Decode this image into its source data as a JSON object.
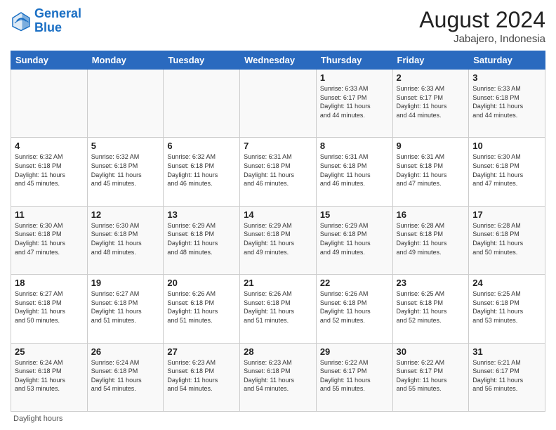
{
  "header": {
    "logo_line1": "General",
    "logo_line2": "Blue",
    "month_year": "August 2024",
    "location": "Jabajero, Indonesia"
  },
  "days_of_week": [
    "Sunday",
    "Monday",
    "Tuesday",
    "Wednesday",
    "Thursday",
    "Friday",
    "Saturday"
  ],
  "footer": {
    "daylight_label": "Daylight hours"
  },
  "weeks": [
    [
      {
        "day": "",
        "info": ""
      },
      {
        "day": "",
        "info": ""
      },
      {
        "day": "",
        "info": ""
      },
      {
        "day": "",
        "info": ""
      },
      {
        "day": "1",
        "info": "Sunrise: 6:33 AM\nSunset: 6:17 PM\nDaylight: 11 hours\nand 44 minutes."
      },
      {
        "day": "2",
        "info": "Sunrise: 6:33 AM\nSunset: 6:17 PM\nDaylight: 11 hours\nand 44 minutes."
      },
      {
        "day": "3",
        "info": "Sunrise: 6:33 AM\nSunset: 6:18 PM\nDaylight: 11 hours\nand 44 minutes."
      }
    ],
    [
      {
        "day": "4",
        "info": "Sunrise: 6:32 AM\nSunset: 6:18 PM\nDaylight: 11 hours\nand 45 minutes."
      },
      {
        "day": "5",
        "info": "Sunrise: 6:32 AM\nSunset: 6:18 PM\nDaylight: 11 hours\nand 45 minutes."
      },
      {
        "day": "6",
        "info": "Sunrise: 6:32 AM\nSunset: 6:18 PM\nDaylight: 11 hours\nand 46 minutes."
      },
      {
        "day": "7",
        "info": "Sunrise: 6:31 AM\nSunset: 6:18 PM\nDaylight: 11 hours\nand 46 minutes."
      },
      {
        "day": "8",
        "info": "Sunrise: 6:31 AM\nSunset: 6:18 PM\nDaylight: 11 hours\nand 46 minutes."
      },
      {
        "day": "9",
        "info": "Sunrise: 6:31 AM\nSunset: 6:18 PM\nDaylight: 11 hours\nand 47 minutes."
      },
      {
        "day": "10",
        "info": "Sunrise: 6:30 AM\nSunset: 6:18 PM\nDaylight: 11 hours\nand 47 minutes."
      }
    ],
    [
      {
        "day": "11",
        "info": "Sunrise: 6:30 AM\nSunset: 6:18 PM\nDaylight: 11 hours\nand 47 minutes."
      },
      {
        "day": "12",
        "info": "Sunrise: 6:30 AM\nSunset: 6:18 PM\nDaylight: 11 hours\nand 48 minutes."
      },
      {
        "day": "13",
        "info": "Sunrise: 6:29 AM\nSunset: 6:18 PM\nDaylight: 11 hours\nand 48 minutes."
      },
      {
        "day": "14",
        "info": "Sunrise: 6:29 AM\nSunset: 6:18 PM\nDaylight: 11 hours\nand 49 minutes."
      },
      {
        "day": "15",
        "info": "Sunrise: 6:29 AM\nSunset: 6:18 PM\nDaylight: 11 hours\nand 49 minutes."
      },
      {
        "day": "16",
        "info": "Sunrise: 6:28 AM\nSunset: 6:18 PM\nDaylight: 11 hours\nand 49 minutes."
      },
      {
        "day": "17",
        "info": "Sunrise: 6:28 AM\nSunset: 6:18 PM\nDaylight: 11 hours\nand 50 minutes."
      }
    ],
    [
      {
        "day": "18",
        "info": "Sunrise: 6:27 AM\nSunset: 6:18 PM\nDaylight: 11 hours\nand 50 minutes."
      },
      {
        "day": "19",
        "info": "Sunrise: 6:27 AM\nSunset: 6:18 PM\nDaylight: 11 hours\nand 51 minutes."
      },
      {
        "day": "20",
        "info": "Sunrise: 6:26 AM\nSunset: 6:18 PM\nDaylight: 11 hours\nand 51 minutes."
      },
      {
        "day": "21",
        "info": "Sunrise: 6:26 AM\nSunset: 6:18 PM\nDaylight: 11 hours\nand 51 minutes."
      },
      {
        "day": "22",
        "info": "Sunrise: 6:26 AM\nSunset: 6:18 PM\nDaylight: 11 hours\nand 52 minutes."
      },
      {
        "day": "23",
        "info": "Sunrise: 6:25 AM\nSunset: 6:18 PM\nDaylight: 11 hours\nand 52 minutes."
      },
      {
        "day": "24",
        "info": "Sunrise: 6:25 AM\nSunset: 6:18 PM\nDaylight: 11 hours\nand 53 minutes."
      }
    ],
    [
      {
        "day": "25",
        "info": "Sunrise: 6:24 AM\nSunset: 6:18 PM\nDaylight: 11 hours\nand 53 minutes."
      },
      {
        "day": "26",
        "info": "Sunrise: 6:24 AM\nSunset: 6:18 PM\nDaylight: 11 hours\nand 54 minutes."
      },
      {
        "day": "27",
        "info": "Sunrise: 6:23 AM\nSunset: 6:18 PM\nDaylight: 11 hours\nand 54 minutes."
      },
      {
        "day": "28",
        "info": "Sunrise: 6:23 AM\nSunset: 6:18 PM\nDaylight: 11 hours\nand 54 minutes."
      },
      {
        "day": "29",
        "info": "Sunrise: 6:22 AM\nSunset: 6:17 PM\nDaylight: 11 hours\nand 55 minutes."
      },
      {
        "day": "30",
        "info": "Sunrise: 6:22 AM\nSunset: 6:17 PM\nDaylight: 11 hours\nand 55 minutes."
      },
      {
        "day": "31",
        "info": "Sunrise: 6:21 AM\nSunset: 6:17 PM\nDaylight: 11 hours\nand 56 minutes."
      }
    ]
  ]
}
